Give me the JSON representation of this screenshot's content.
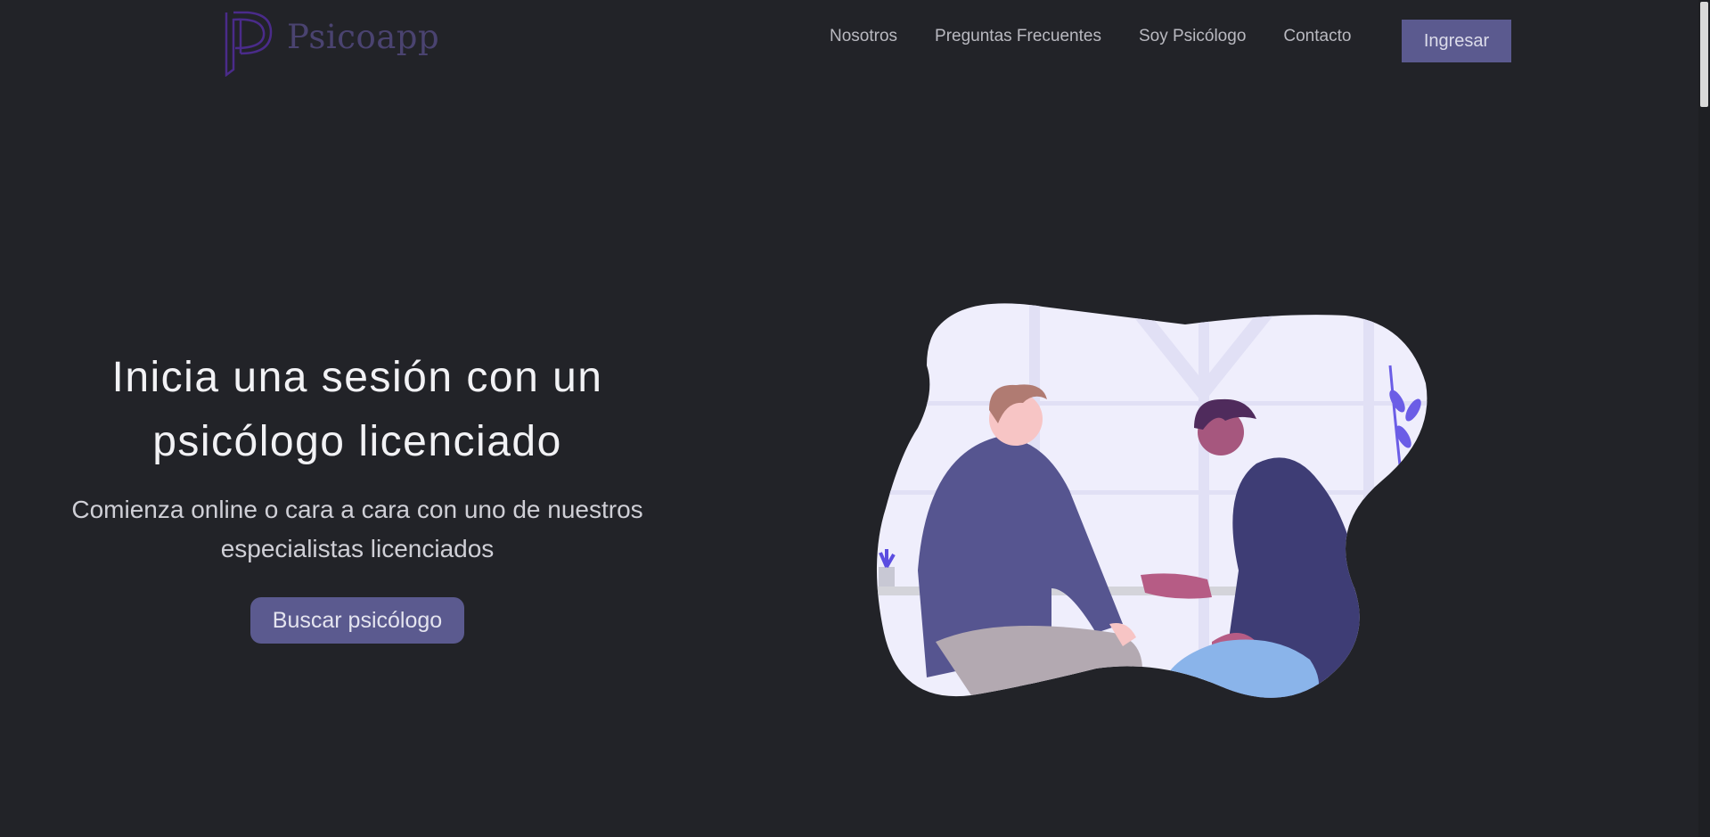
{
  "brand": {
    "name": "Psicoapp",
    "logo_icon": "psicoapp-logo-icon",
    "logo_color": "#4a2b8a"
  },
  "nav": {
    "items": [
      {
        "label": "Nosotros"
      },
      {
        "label": "Preguntas Frecuentes"
      },
      {
        "label": "Soy Psicólogo"
      },
      {
        "label": "Contacto"
      }
    ],
    "login_label": "Ingresar"
  },
  "hero": {
    "title_line1": "Inicia una sesión con un",
    "title_line2": "psicólogo licenciado",
    "subtitle_line1": "Comienza online o cara a cara con uno de nuestros",
    "subtitle_line2": "especialistas licenciados",
    "cta_label": "Buscar psicólogo",
    "illustration": "therapy-session-illustration"
  },
  "colors": {
    "background": "#222328",
    "accent": "#5b5a8f",
    "text_light": "#f2f2f5"
  }
}
